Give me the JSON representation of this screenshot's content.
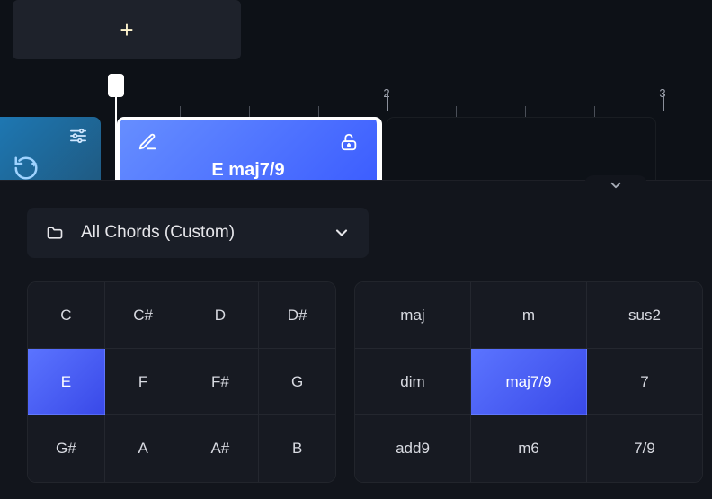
{
  "toolbar": {
    "add_label": "+"
  },
  "ruler": {
    "markers": [
      {
        "pos": 430,
        "label": "2"
      },
      {
        "pos": 737,
        "label": "3"
      }
    ]
  },
  "clip": {
    "chord_name": "E maj7/9"
  },
  "library": {
    "selected_label": "All Chords (Custom)"
  },
  "notes": [
    [
      "C",
      "C#",
      "D",
      "D#"
    ],
    [
      "E",
      "F",
      "F#",
      "G"
    ],
    [
      "G#",
      "A",
      "A#",
      "B"
    ]
  ],
  "selected_note": "E",
  "types": [
    [
      "maj",
      "m",
      "sus2"
    ],
    [
      "dim",
      "maj7/9",
      "7"
    ],
    [
      "add9",
      "m6",
      "7/9"
    ]
  ],
  "selected_type": "maj7/9"
}
